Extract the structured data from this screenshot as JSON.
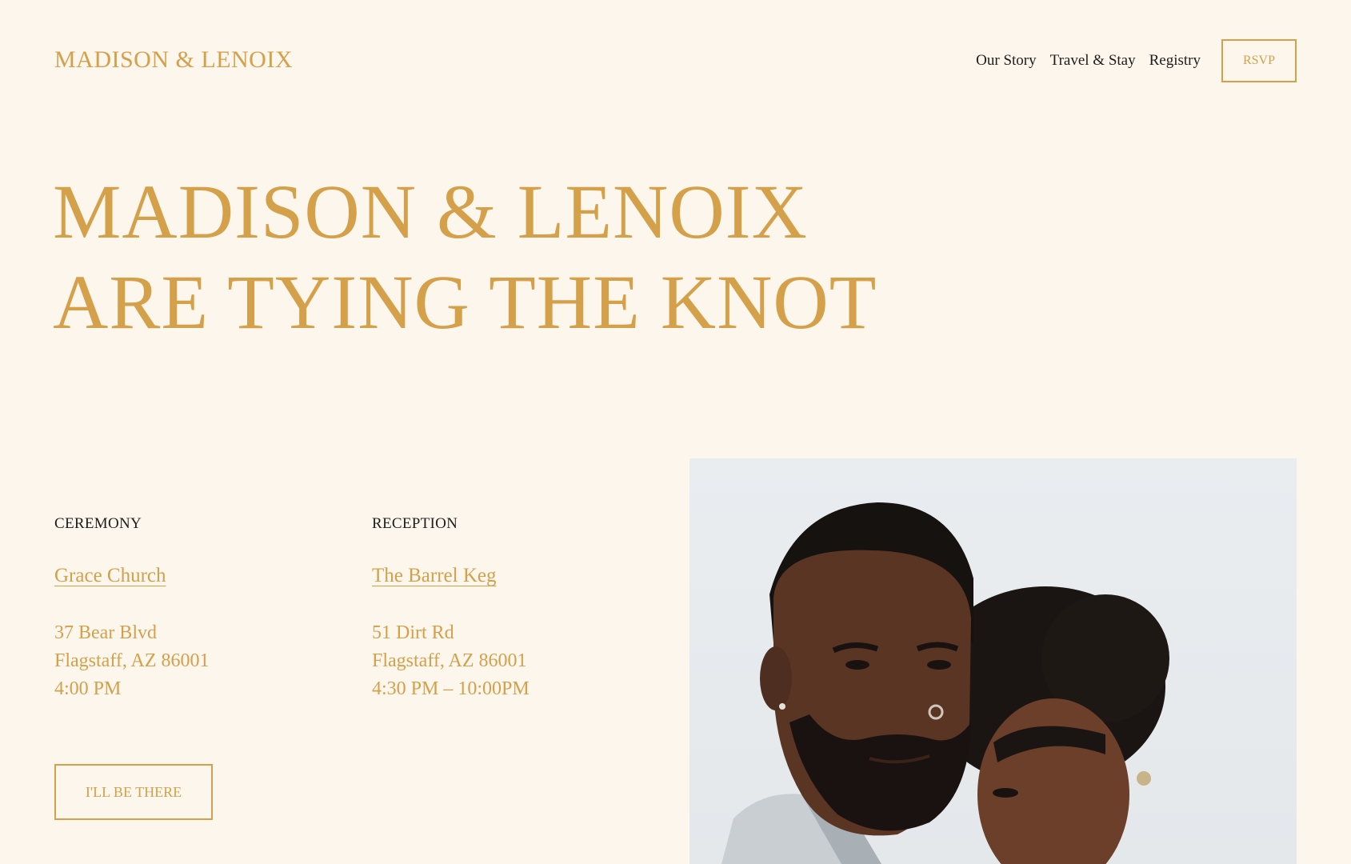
{
  "header": {
    "logo": "MADISON & LENOIX",
    "nav": [
      "Our Story",
      "Travel & Stay",
      "Registry"
    ],
    "rsvp_label": "RSVP"
  },
  "hero": {
    "line1": "MADISON & LENOIX",
    "line2": "ARE TYING THE KNOT"
  },
  "ceremony": {
    "heading": "CEREMONY",
    "venue": "Grace Church",
    "street": "37 Bear Blvd",
    "city": "Flagstaff, AZ 86001",
    "time": "4:00 PM"
  },
  "reception": {
    "heading": "RECEPTION",
    "venue": "The Barrel Keg",
    "street": "51 Dirt Rd",
    "city": "Flagstaff, AZ 86001",
    "time": "4:30 PM – 10:00PM"
  },
  "attend_label": "I'LL BE THERE",
  "colors": {
    "background": "#fdf6ec",
    "accent": "#d4a04a",
    "text": "#1c1c1c"
  }
}
